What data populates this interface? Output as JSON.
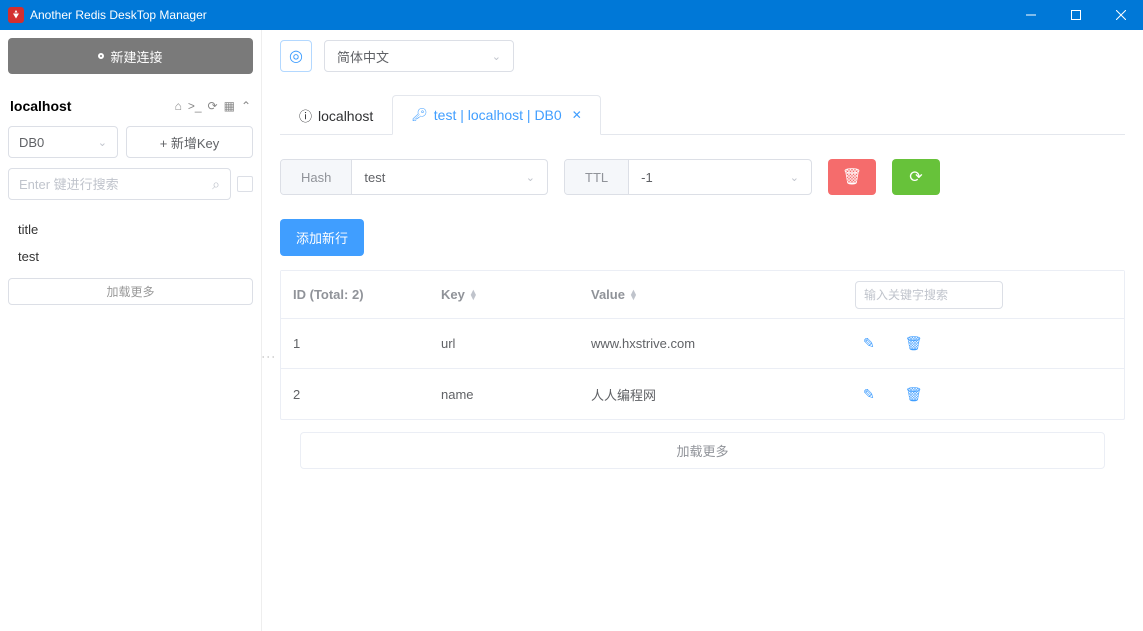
{
  "window": {
    "title": "Another Redis DeskTop Manager"
  },
  "sidebar": {
    "newConnection": "新建连接",
    "connectionName": "localhost",
    "dbSelect": "DB0",
    "newKey": "+ 新增Key",
    "searchPlaceholder": "Enter 键进行搜索",
    "keys": [
      "title",
      "test"
    ],
    "loadMore": "加载更多"
  },
  "topbar": {
    "language": "简体中文"
  },
  "tabs": [
    {
      "label": "localhost",
      "active": false
    },
    {
      "label": "test | localhost | DB0",
      "active": true
    }
  ],
  "keyDetail": {
    "type": "Hash",
    "name": "test",
    "ttlLabel": "TTL",
    "ttlValue": "-1",
    "addRow": "添加新行"
  },
  "table": {
    "idHeader": "ID (Total: 2)",
    "keyHeader": "Key",
    "valueHeader": "Value",
    "searchPlaceholder": "输入关键字搜索",
    "rows": [
      {
        "id": "1",
        "key": "url",
        "value": "www.hxstrive.com"
      },
      {
        "id": "2",
        "key": "name",
        "value": "人人编程网"
      }
    ],
    "loadMore": "加载更多"
  }
}
